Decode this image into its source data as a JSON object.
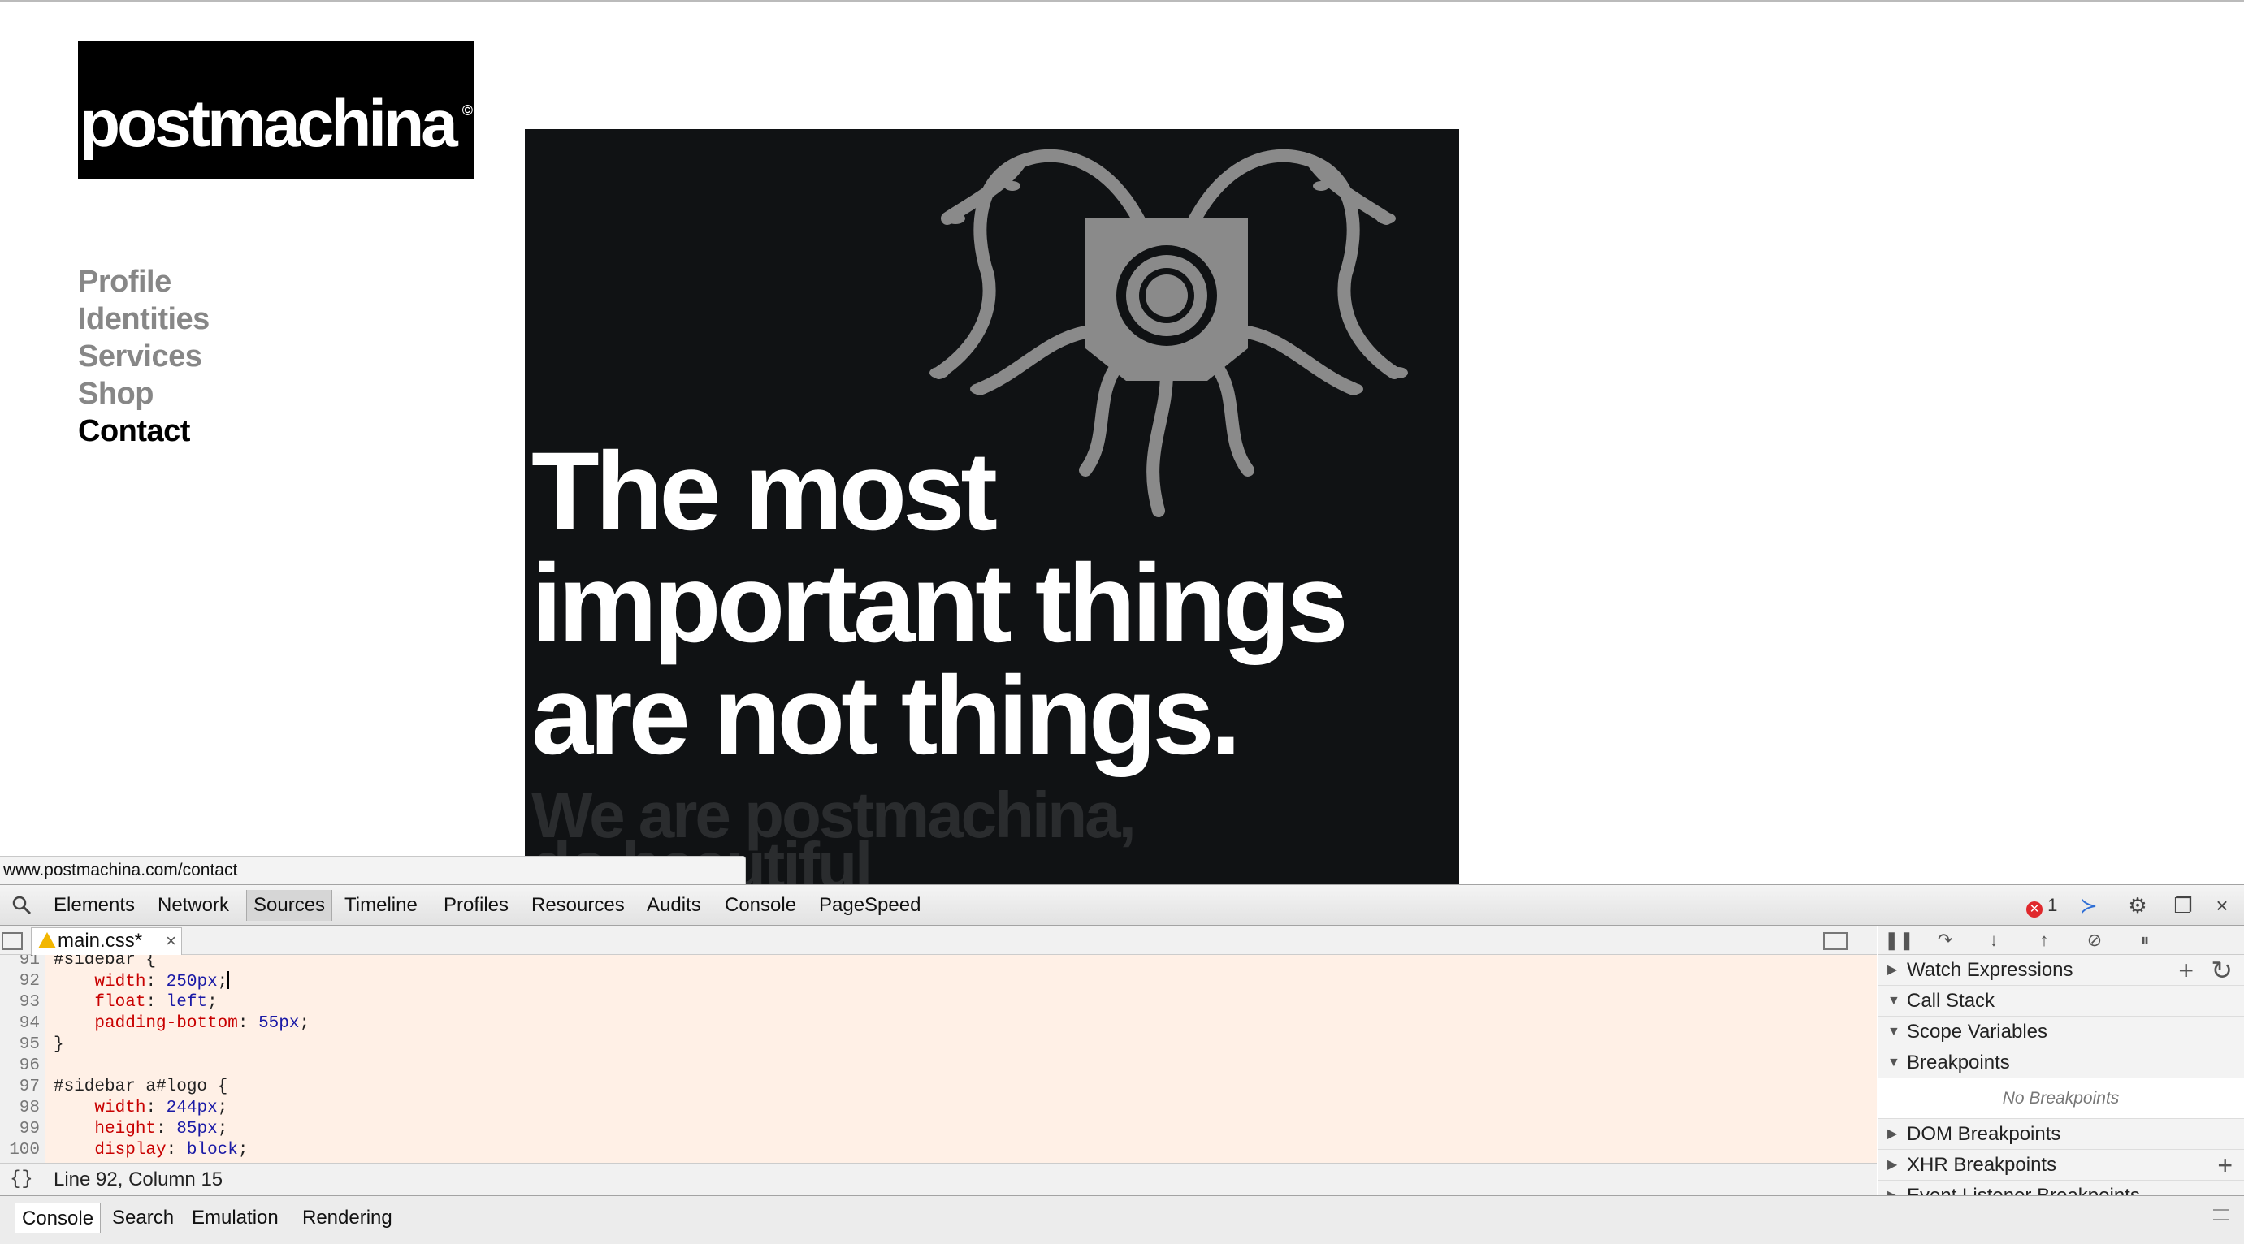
{
  "site": {
    "logo_text": "postmachina",
    "logo_mark": "©",
    "nav": [
      {
        "label": "Profile",
        "active": false
      },
      {
        "label": "Identities",
        "active": false
      },
      {
        "label": "Services",
        "active": false
      },
      {
        "label": "Shop",
        "active": false
      },
      {
        "label": "Contact",
        "active": true
      }
    ],
    "poster": {
      "headline": [
        "The most",
        "important things",
        "are not things."
      ],
      "subline": [
        "We are postmachina,",
        "do beautiful"
      ]
    },
    "status_url": "www.postmachina.com/contact"
  },
  "devtools": {
    "tabs": [
      "Elements",
      "Network",
      "Sources",
      "Timeline",
      "Profiles",
      "Resources",
      "Audits",
      "Console",
      "PageSpeed"
    ],
    "selected_tab": "Sources",
    "error_count": "1",
    "file_tab": "main.css*",
    "code": [
      {
        "ln": "91",
        "text": "#sidebar {"
      },
      {
        "ln": "92",
        "prop": "width",
        "val": "250px"
      },
      {
        "ln": "93",
        "prop": "float",
        "val": "left"
      },
      {
        "ln": "94",
        "prop": "padding-bottom",
        "val": "55px"
      },
      {
        "ln": "95",
        "text": "}"
      },
      {
        "ln": "96",
        "text": ""
      },
      {
        "ln": "97",
        "text": "#sidebar a#logo {"
      },
      {
        "ln": "98",
        "prop": "width",
        "val": "244px"
      },
      {
        "ln": "99",
        "prop": "height",
        "val": "85px"
      },
      {
        "ln": "100",
        "prop": "display",
        "val": "block"
      }
    ],
    "status": {
      "braces": "{}",
      "position": "Line 92, Column 15"
    },
    "debugger": {
      "panes": [
        "Watch Expressions",
        "Call Stack",
        "Scope Variables",
        "Breakpoints",
        "DOM Breakpoints",
        "XHR Breakpoints",
        "Event Listener Breakpoints"
      ],
      "no_breakpoints": "No Breakpoints"
    },
    "drawer_tabs": [
      "Console",
      "Search",
      "Emulation",
      "Rendering"
    ]
  },
  "icons": [
    "search-icon",
    "error-icon",
    "console-drawer-icon",
    "gear-icon",
    "dock-icon",
    "close-icon",
    "warning-icon",
    "pause-icon",
    "step-over-icon",
    "step-into-icon",
    "step-out-icon",
    "deactivate-breakpoints-icon",
    "pause-on-exceptions-icon",
    "add-icon",
    "refresh-icon"
  ],
  "colors": {
    "accent_error": "#e0282c",
    "code_bg": "#fff0e6",
    "poster_bg": "#101214",
    "nav_inactive": "#878787"
  }
}
